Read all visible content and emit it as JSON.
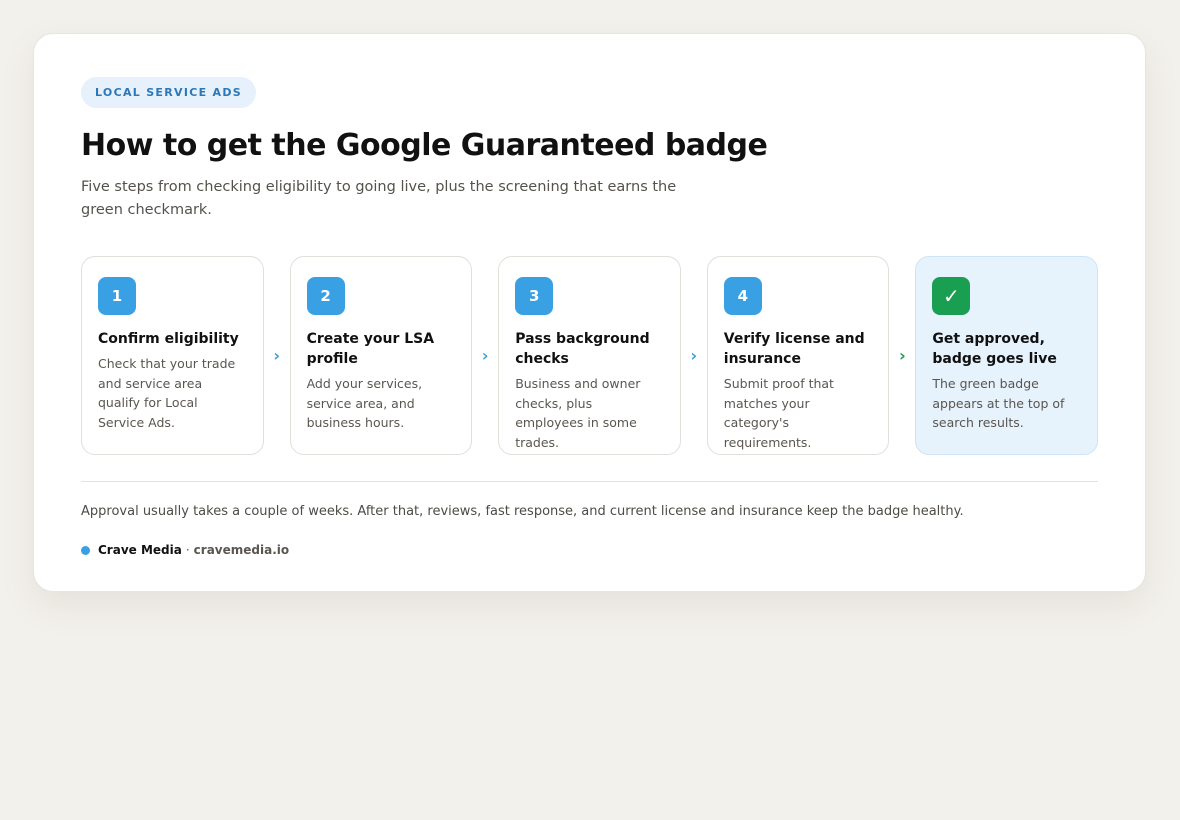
{
  "tag": "LOCAL SERVICE ADS",
  "title": "How to get the Google Guaranteed badge",
  "subtitle": "Five steps from checking eligibility to going live, plus the screening that earns the green checkmark.",
  "steps": [
    {
      "marker": "1",
      "title": "Confirm eligibility",
      "desc": "Check that your trade and service area qualify for Local Service Ads."
    },
    {
      "marker": "2",
      "title": "Create your LSA profile",
      "desc": "Add your services, service area, and business hours."
    },
    {
      "marker": "3",
      "title": "Pass background checks",
      "desc": "Business and owner checks, plus employees in some trades."
    },
    {
      "marker": "4",
      "title": "Verify license and insurance",
      "desc": "Submit proof that matches your category's requirements."
    },
    {
      "marker": "✓",
      "title": "Get approved, badge goes live",
      "desc": "The green badge appears at the top of search results."
    }
  ],
  "arrows": [
    "›",
    "›",
    "›",
    "›"
  ],
  "footer_note": "Approval usually takes a couple of weeks. After that, reviews, fast response, and current license and insurance keep the badge healthy.",
  "brand": {
    "name": "Crave Media",
    "separator": "·",
    "url": "cravemedia.io"
  },
  "colors": {
    "accent_blue": "#3aa0e4",
    "success_green": "#1a9e52",
    "final_step_bg": "#e6f2fc"
  }
}
